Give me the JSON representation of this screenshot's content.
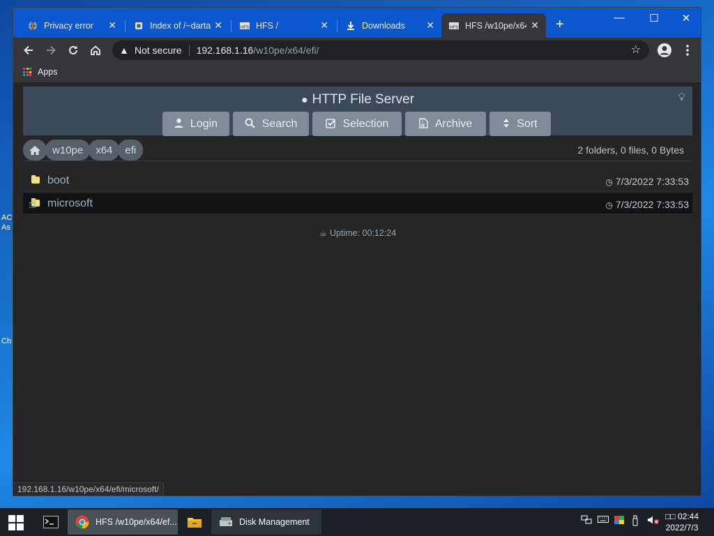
{
  "desktop": {
    "fragments": [
      "AC",
      "As",
      "Ch"
    ]
  },
  "browser": {
    "tabs": [
      {
        "title": "Privacy error",
        "icon": "globe-icon"
      },
      {
        "title": "Index of /~darta",
        "icon": "server-icon"
      },
      {
        "title": "HFS /",
        "icon": "hfs-icon"
      },
      {
        "title": "Downloads",
        "icon": "download-icon"
      },
      {
        "title": "HFS /w10pe/x64",
        "icon": "hfs-icon"
      }
    ],
    "security_label": "Not secure",
    "url_host": "192.168.1.16",
    "url_path": "/w10pe/x64/efi/",
    "bookmarks": {
      "apps_label": "Apps"
    },
    "status_url": "192.168.1.16/w10pe/x64/efi/microsoft/"
  },
  "hfs": {
    "title": "HTTP File Server",
    "buttons": {
      "login": "Login",
      "search": "Search",
      "selection": "Selection",
      "archive": "Archive",
      "sort": "Sort"
    },
    "breadcrumb": [
      "w10pe",
      "x64",
      "efi"
    ],
    "summary": "2 folders, 0 files, 0 Bytes",
    "entries": [
      {
        "name": "boot",
        "date": "7/3/2022 7:33:53"
      },
      {
        "name": "microsoft",
        "date": "7/3/2022 7:33:53"
      }
    ],
    "uptime": "Uptime: 00:12:24"
  },
  "taskbar": {
    "items": [
      {
        "label": ""
      },
      {
        "label": "HFS /w10pe/x64/ef..."
      },
      {
        "label": ""
      },
      {
        "label": "Disk Management"
      }
    ],
    "time": "02:44",
    "date": "2022/7/3",
    "ime": "□□"
  },
  "colors": {
    "accent": "#0b57d0",
    "hfs_header": "#3b4a5a",
    "hfs_button": "#7f8b99",
    "folder": "#f1e27b",
    "link": "#9fb3c8"
  }
}
